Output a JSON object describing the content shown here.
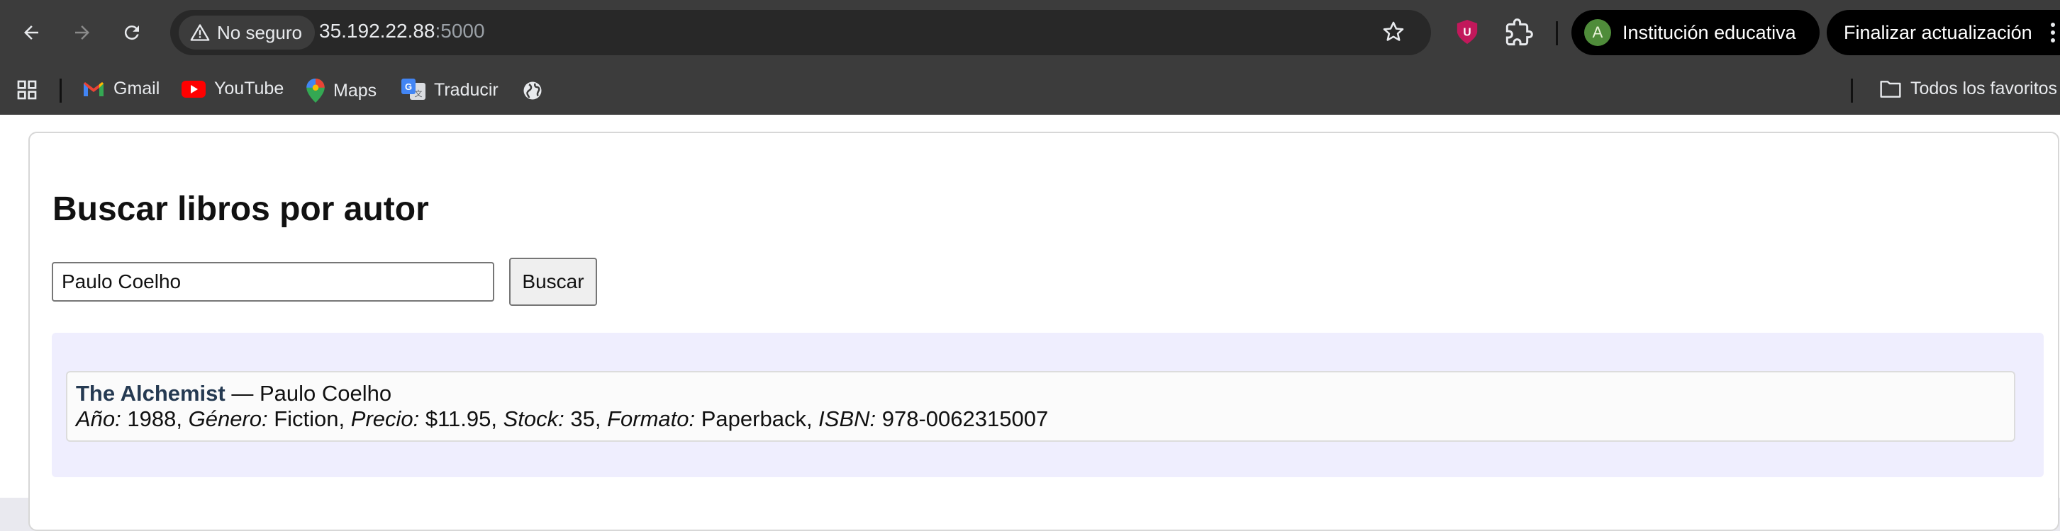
{
  "browser": {
    "security_label": "No seguro",
    "url_host": "35.192.22.88",
    "url_port": ":5000",
    "profile_initial": "A",
    "profile_label": "Institución educativa",
    "update_label": "Finalizar actualización",
    "bookmarks": [
      "Gmail",
      "YouTube",
      "Maps",
      "Traducir"
    ],
    "all_bookmarks_label": "Todos los favoritos"
  },
  "page": {
    "heading": "Buscar libros por autor",
    "search": {
      "value": "Paulo Coelho"
    },
    "search_button": "Buscar",
    "result": {
      "title": "The Alchemist",
      "separator": " — ",
      "author": "Paulo Coelho",
      "fields": [
        {
          "label": "Año:",
          "value": " 1988, "
        },
        {
          "label": "Género:",
          "value": " Fiction, "
        },
        {
          "label": "Precio:",
          "value": " $11.95, "
        },
        {
          "label": "Stock:",
          "value": " 35, "
        },
        {
          "label": "Formato:",
          "value": " Paperback, "
        },
        {
          "label": "ISBN:",
          "value": " 978-0062315007"
        }
      ]
    }
  }
}
